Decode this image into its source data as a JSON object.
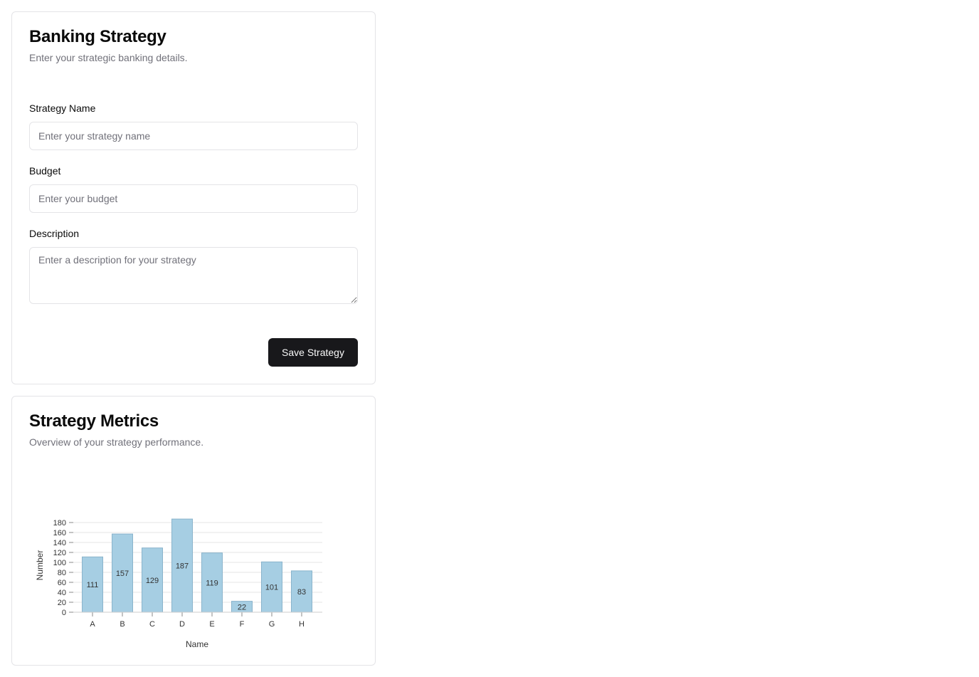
{
  "form_card": {
    "title": "Banking Strategy",
    "description": "Enter your strategic banking details.",
    "fields": {
      "strategy_name": {
        "label": "Strategy Name",
        "placeholder": "Enter your strategy name",
        "value": ""
      },
      "budget": {
        "label": "Budget",
        "placeholder": "Enter your budget",
        "value": ""
      },
      "description": {
        "label": "Description",
        "placeholder": "Enter a description for your strategy",
        "value": ""
      }
    },
    "save_label": "Save Strategy"
  },
  "metrics_card": {
    "title": "Strategy Metrics",
    "description": "Overview of your strategy performance."
  },
  "colors": {
    "bar_fill": "#a6cee3",
    "bar_stroke": "#8ab4cc",
    "button_bg": "#18181b",
    "muted_text": "#71717a",
    "border": "#e4e4e7"
  },
  "chart_data": {
    "type": "bar",
    "categories": [
      "A",
      "B",
      "C",
      "D",
      "E",
      "F",
      "G",
      "H"
    ],
    "values": [
      111,
      157,
      129,
      187,
      119,
      22,
      101,
      83
    ],
    "xlabel": "Name",
    "ylabel": "Number",
    "ylim": [
      0,
      180
    ],
    "yticks": [
      0,
      20,
      40,
      60,
      80,
      100,
      120,
      140,
      160,
      180
    ],
    "grid": true,
    "data_labels": true
  }
}
